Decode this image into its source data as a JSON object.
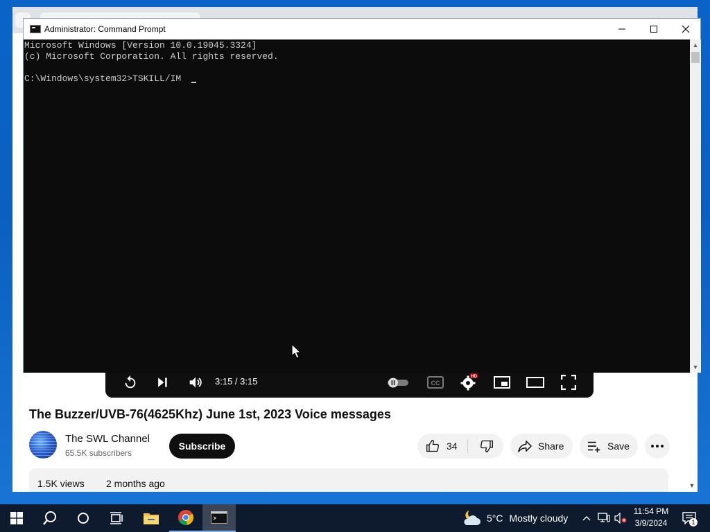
{
  "cmd": {
    "title": "Administrator: Command Prompt",
    "lines": [
      "Microsoft Windows [Version 10.0.19045.3324]",
      "(c) Microsoft Corporation. All rights reserved.",
      "",
      "C:\\Windows\\system32>TSKILL/IM"
    ]
  },
  "player": {
    "time": "3:15 / 3:15",
    "hd_badge": "HD"
  },
  "video": {
    "title": "The Buzzer/UVB-76(4625Khz) June 1st, 2023 Voice messages",
    "channel_name": "The SWL Channel",
    "subscribers": "65.5K subscribers",
    "subscribe_label": "Subscribe",
    "like_count": "34",
    "share_label": "Share",
    "save_label": "Save",
    "views": "1.5K views",
    "uploaded": "2 months ago"
  },
  "taskbar": {
    "weather_temp": "5°C",
    "weather_cond": "Mostly cloudy",
    "time": "11:54 PM",
    "date": "3/9/2024",
    "notification_count": "1"
  },
  "colors": {
    "desktop": "#0b5fc0",
    "console_bg": "#0c0c0c",
    "console_text": "#cccccc",
    "taskbar": "#0e1b2e",
    "subscribe_bg": "#0f0f0f",
    "hd_badge": "#cc0000"
  }
}
